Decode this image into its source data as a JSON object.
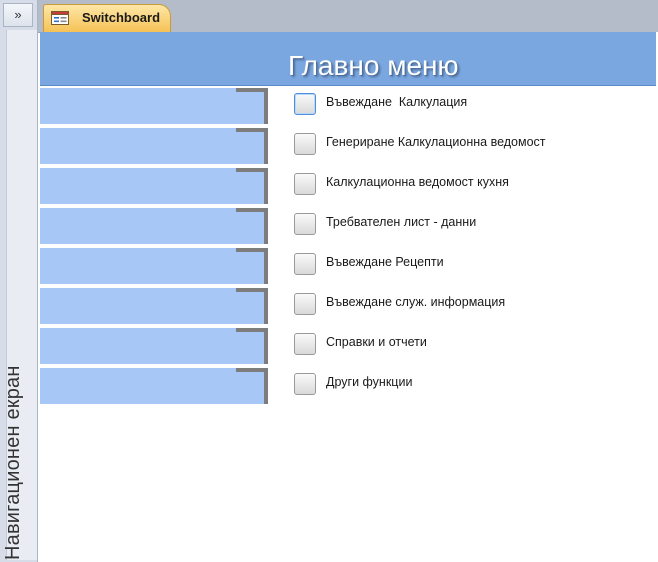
{
  "nav_pane": {
    "toggle_glyph": "»",
    "label": "Навигационен екран"
  },
  "tab": {
    "label": "Switchboard",
    "icon": "form-icon"
  },
  "form": {
    "title": "Главно меню",
    "accent_color": "#7ba7e1",
    "bar_color": "#a7c8f7"
  },
  "menu_items": [
    {
      "label": "Въвеждане  Калкулация"
    },
    {
      "label": "Генериране Калкулационна ведомост"
    },
    {
      "label": "Калкулационна ведомост кухня"
    },
    {
      "label": "Требвателен лист - данни"
    },
    {
      "label": "Въвеждане Рецепти"
    },
    {
      "label": "Въвеждане служ. информация"
    },
    {
      "label": "Справки и отчети"
    },
    {
      "label": "Други функции"
    }
  ]
}
